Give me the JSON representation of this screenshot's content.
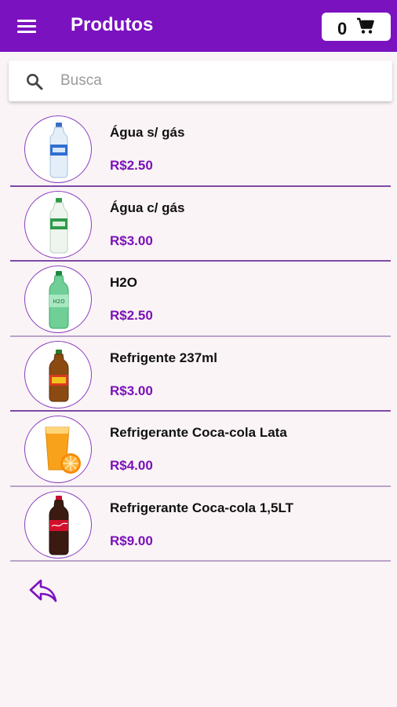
{
  "header": {
    "title": "Produtos",
    "menu_icon": "hamburger-menu-icon",
    "cart_count": "0",
    "cart_icon": "shopping-cart-icon"
  },
  "search": {
    "placeholder": "Busca",
    "value": "",
    "icon": "search-icon"
  },
  "products": [
    {
      "name": "Água s/ gás",
      "price": "R$2.50",
      "image": "water-bottle-icon"
    },
    {
      "name": "Água c/ gás",
      "price": "R$3.00",
      "image": "sparkling-water-bottle-icon"
    },
    {
      "name": "H2O",
      "price": "R$2.50",
      "image": "green-soda-bottle-icon"
    },
    {
      "name": "Refrigente 237ml",
      "price": "R$3.00",
      "image": "small-soda-bottle-icon"
    },
    {
      "name": "Refrigerante Coca-cola Lata",
      "price": "R$4.00",
      "image": "orange-juice-icon"
    },
    {
      "name": "Refrigerante Coca-cola 1,5LT",
      "price": "R$9.00",
      "image": "cola-bottle-icon"
    }
  ],
  "footer": {
    "back_icon": "reply-back-arrow-icon"
  },
  "colors": {
    "primary": "#7b12c0",
    "price": "#7a12b8",
    "background": "#fbf4f6",
    "divider": "#b9a3c9"
  }
}
